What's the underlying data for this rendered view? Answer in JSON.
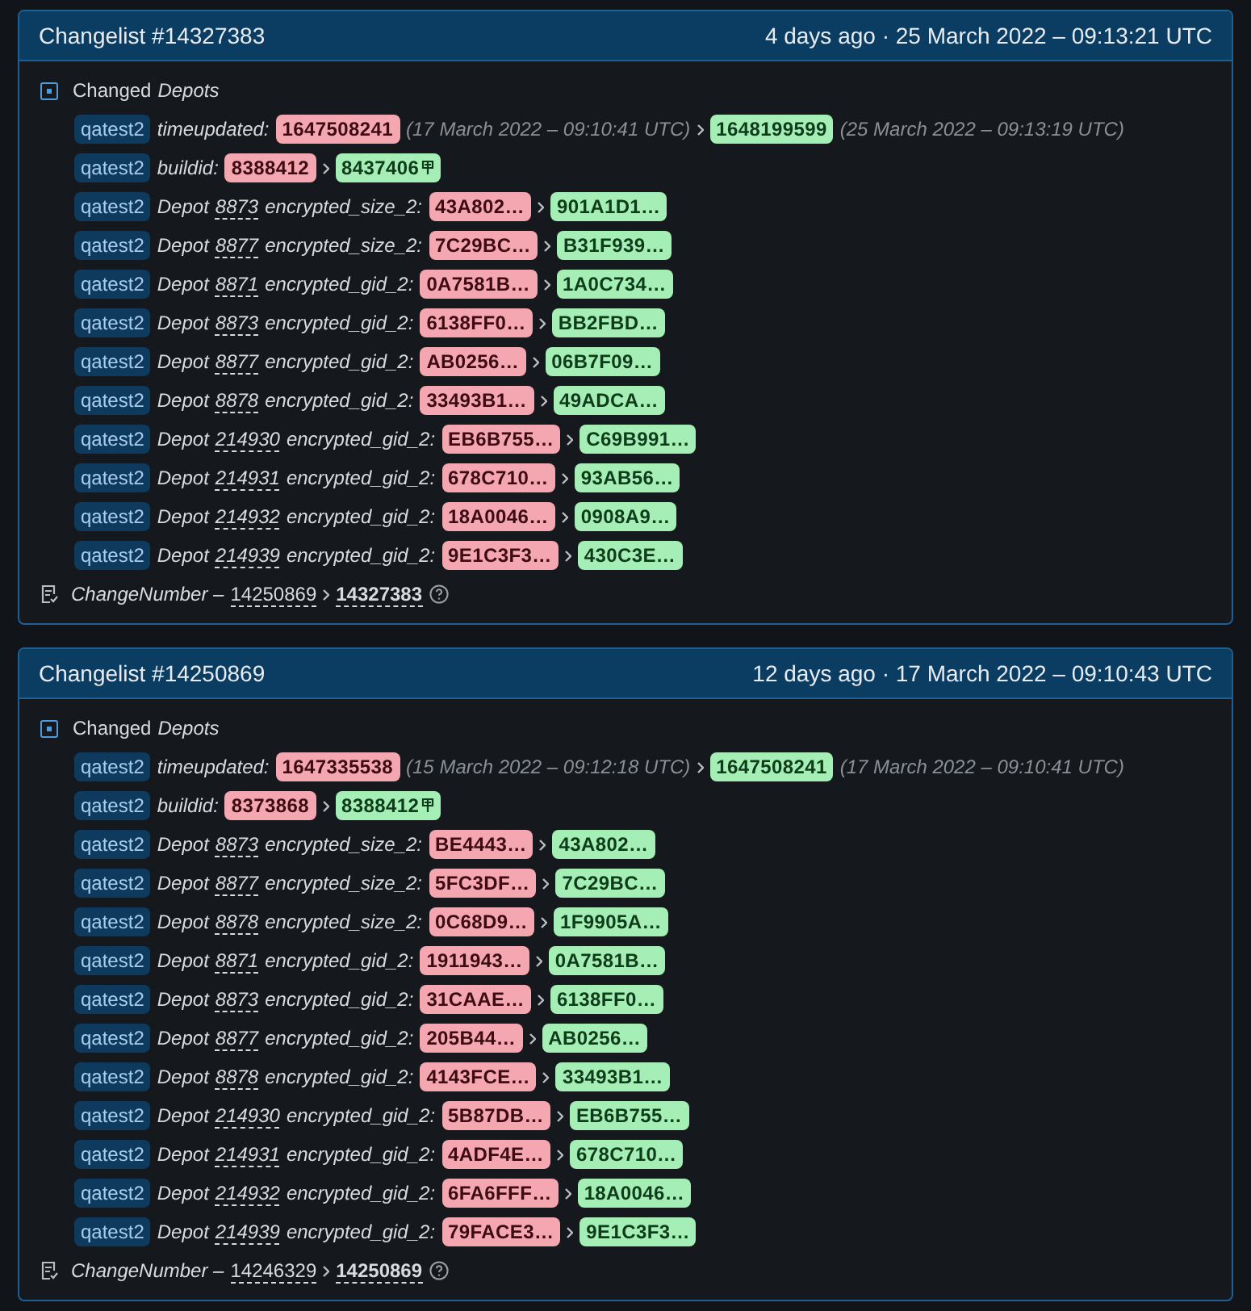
{
  "changelists": [
    {
      "title": "Changelist #14327383",
      "date": "4 days ago · 25 March 2022 – 09:13:21 UTC",
      "section": {
        "label": "Changed",
        "name": "Depots"
      },
      "rows": [
        {
          "kind": "time",
          "app": "qatest2",
          "key": "timeupdated:",
          "old": "1647508241",
          "old_note": "(17 March 2022 – 09:10:41 UTC)",
          "new": "1648199599",
          "new_note": "(25 March 2022 – 09:13:19 UTC)"
        },
        {
          "kind": "build",
          "app": "qatest2",
          "key": "buildid:",
          "old": "8388412",
          "new": "8437406"
        },
        {
          "kind": "depot",
          "app": "qatest2",
          "prefix": "Depot",
          "depot": "8873",
          "key": "encrypted_size_2:",
          "old": "43A802…",
          "new": "901A1D1…"
        },
        {
          "kind": "depot",
          "app": "qatest2",
          "prefix": "Depot",
          "depot": "8877",
          "key": "encrypted_size_2:",
          "old": "7C29BC…",
          "new": "B31F939…"
        },
        {
          "kind": "depot",
          "app": "qatest2",
          "prefix": "Depot",
          "depot": "8871",
          "key": "encrypted_gid_2:",
          "old": "0A7581B…",
          "new": "1A0C734…"
        },
        {
          "kind": "depot",
          "app": "qatest2",
          "prefix": "Depot",
          "depot": "8873",
          "key": "encrypted_gid_2:",
          "old": "6138FF0…",
          "new": "BB2FBD…"
        },
        {
          "kind": "depot",
          "app": "qatest2",
          "prefix": "Depot",
          "depot": "8877",
          "key": "encrypted_gid_2:",
          "old": "AB0256…",
          "new": "06B7F09…"
        },
        {
          "kind": "depot",
          "app": "qatest2",
          "prefix": "Depot",
          "depot": "8878",
          "key": "encrypted_gid_2:",
          "old": "33493B1…",
          "new": "49ADCA…"
        },
        {
          "kind": "depot",
          "app": "qatest2",
          "prefix": "Depot",
          "depot": "214930",
          "key": "encrypted_gid_2:",
          "old": "EB6B755…",
          "new": "C69B991…"
        },
        {
          "kind": "depot",
          "app": "qatest2",
          "prefix": "Depot",
          "depot": "214931",
          "key": "encrypted_gid_2:",
          "old": "678C710…",
          "new": "93AB56…"
        },
        {
          "kind": "depot",
          "app": "qatest2",
          "prefix": "Depot",
          "depot": "214932",
          "key": "encrypted_gid_2:",
          "old": "18A0046…",
          "new": "0908A9…"
        },
        {
          "kind": "depot",
          "app": "qatest2",
          "prefix": "Depot",
          "depot": "214939",
          "key": "encrypted_gid_2:",
          "old": "9E1C3F3…",
          "new": "430C3E…"
        }
      ],
      "footer": {
        "label": "ChangeNumber –",
        "old": "14250869",
        "new": "14327383"
      }
    },
    {
      "title": "Changelist #14250869",
      "date": "12 days ago · 17 March 2022 – 09:10:43 UTC",
      "section": {
        "label": "Changed",
        "name": "Depots"
      },
      "rows": [
        {
          "kind": "time",
          "app": "qatest2",
          "key": "timeupdated:",
          "old": "1647335538",
          "old_note": "(15 March 2022 – 09:12:18 UTC)",
          "new": "1647508241",
          "new_note": "(17 March 2022 – 09:10:41 UTC)"
        },
        {
          "kind": "build",
          "app": "qatest2",
          "key": "buildid:",
          "old": "8373868",
          "new": "8388412"
        },
        {
          "kind": "depot",
          "app": "qatest2",
          "prefix": "Depot",
          "depot": "8873",
          "key": "encrypted_size_2:",
          "old": "BE4443…",
          "new": "43A802…"
        },
        {
          "kind": "depot",
          "app": "qatest2",
          "prefix": "Depot",
          "depot": "8877",
          "key": "encrypted_size_2:",
          "old": "5FC3DF…",
          "new": "7C29BC…"
        },
        {
          "kind": "depot",
          "app": "qatest2",
          "prefix": "Depot",
          "depot": "8878",
          "key": "encrypted_size_2:",
          "old": "0C68D9…",
          "new": "1F9905A…"
        },
        {
          "kind": "depot",
          "app": "qatest2",
          "prefix": "Depot",
          "depot": "8871",
          "key": "encrypted_gid_2:",
          "old": "1911943…",
          "new": "0A7581B…"
        },
        {
          "kind": "depot",
          "app": "qatest2",
          "prefix": "Depot",
          "depot": "8873",
          "key": "encrypted_gid_2:",
          "old": "31CAAE…",
          "new": "6138FF0…"
        },
        {
          "kind": "depot",
          "app": "qatest2",
          "prefix": "Depot",
          "depot": "8877",
          "key": "encrypted_gid_2:",
          "old": "205B44…",
          "new": "AB0256…"
        },
        {
          "kind": "depot",
          "app": "qatest2",
          "prefix": "Depot",
          "depot": "8878",
          "key": "encrypted_gid_2:",
          "old": "4143FCE…",
          "new": "33493B1…"
        },
        {
          "kind": "depot",
          "app": "qatest2",
          "prefix": "Depot",
          "depot": "214930",
          "key": "encrypted_gid_2:",
          "old": "5B87DB…",
          "new": "EB6B755…"
        },
        {
          "kind": "depot",
          "app": "qatest2",
          "prefix": "Depot",
          "depot": "214931",
          "key": "encrypted_gid_2:",
          "old": "4ADF4E…",
          "new": "678C710…"
        },
        {
          "kind": "depot",
          "app": "qatest2",
          "prefix": "Depot",
          "depot": "214932",
          "key": "encrypted_gid_2:",
          "old": "6FA6FFF…",
          "new": "18A0046…"
        },
        {
          "kind": "depot",
          "app": "qatest2",
          "prefix": "Depot",
          "depot": "214939",
          "key": "encrypted_gid_2:",
          "old": "79FACE3…",
          "new": "9E1C3F3…"
        }
      ],
      "footer": {
        "label": "ChangeNumber –",
        "old": "14246329",
        "new": "14250869"
      }
    }
  ]
}
